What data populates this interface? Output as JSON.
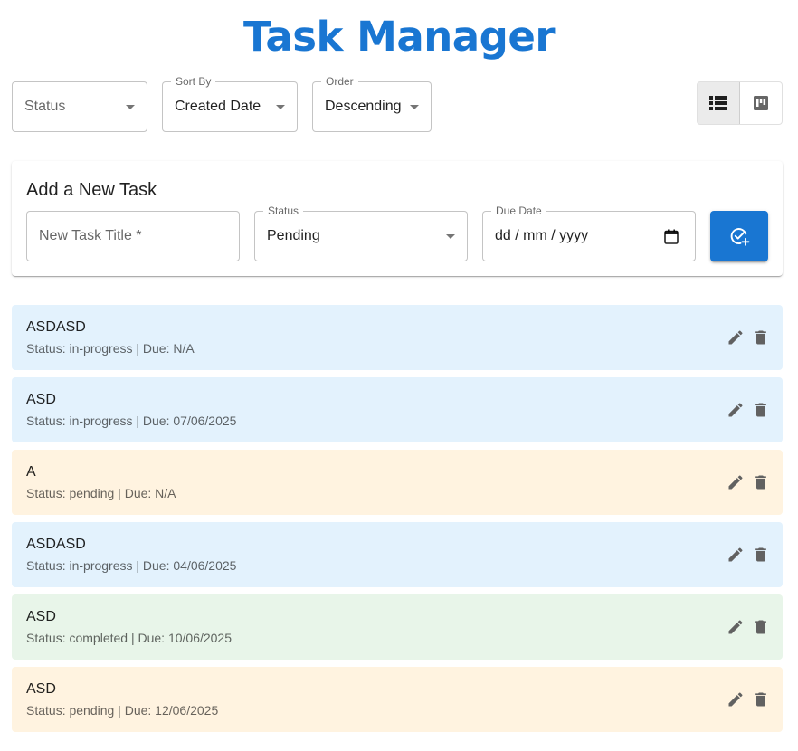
{
  "header": {
    "title": "Task Manager"
  },
  "filters": {
    "status": {
      "placeholder": "Status"
    },
    "sort_by": {
      "label": "Sort By",
      "value": "Created Date"
    },
    "order": {
      "label": "Order",
      "value": "Descending"
    }
  },
  "view_toggle": {
    "active": "list",
    "icons": [
      "list-view-icon",
      "board-view-icon"
    ]
  },
  "add_form": {
    "heading": "Add a New Task",
    "title_placeholder": "New Task Title *",
    "status_label": "Status",
    "status_value": "Pending",
    "due_label": "Due Date",
    "due_placeholder": "dd / mm / yyyy",
    "submit_icon": "add-task-icon"
  },
  "colors": {
    "accent": "#1976d2",
    "in-progress": "#e3f2fd",
    "pending": "#fff3e0",
    "completed": "#e8f5e9",
    "icon": "#616161"
  },
  "tasks": [
    {
      "title": "ASDASD",
      "subtitle": "Status: in-progress | Due: N/A",
      "status": "in-progress"
    },
    {
      "title": "ASD",
      "subtitle": "Status: in-progress | Due: 07/06/2025",
      "status": "in-progress"
    },
    {
      "title": "A",
      "subtitle": "Status: pending | Due: N/A",
      "status": "pending"
    },
    {
      "title": "ASDASD",
      "subtitle": "Status: in-progress | Due: 04/06/2025",
      "status": "in-progress"
    },
    {
      "title": "ASD",
      "subtitle": "Status: completed | Due: 10/06/2025",
      "status": "completed"
    },
    {
      "title": "ASD",
      "subtitle": "Status: pending | Due: 12/06/2025",
      "status": "pending"
    }
  ]
}
